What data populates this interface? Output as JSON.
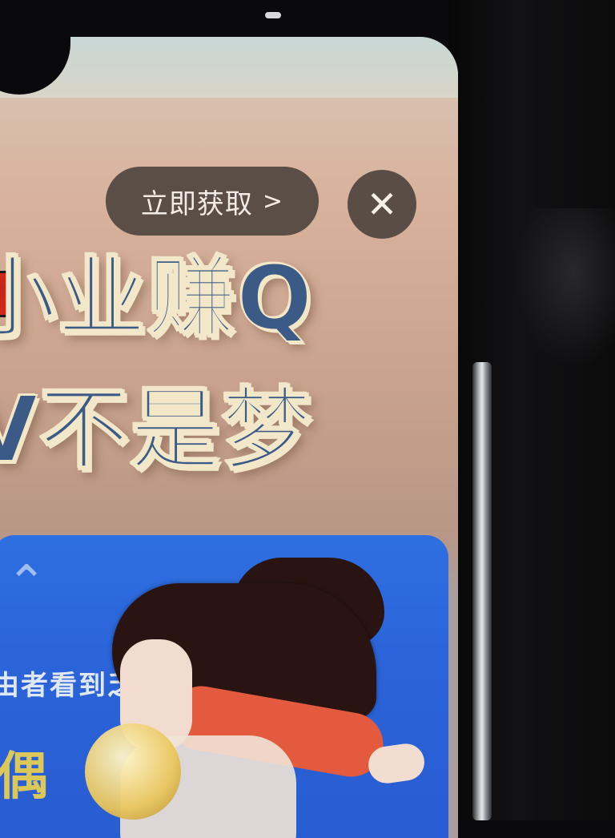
{
  "cta": {
    "label": "立即获取",
    "chevron": ">"
  },
  "close": {
    "icon": "close-icon",
    "glyph": "✕"
  },
  "headline": {
    "line1": "小业赚Q",
    "line2": "V不是梦"
  },
  "banner": {
    "subtitle": "由者看到乏",
    "big_text": "偶"
  },
  "colors": {
    "cta_bg": "#5b4e47",
    "headline_fill": "#3c5a86",
    "headline_outline": "#f3e7c9",
    "banner_bg": "#2b63d9"
  }
}
